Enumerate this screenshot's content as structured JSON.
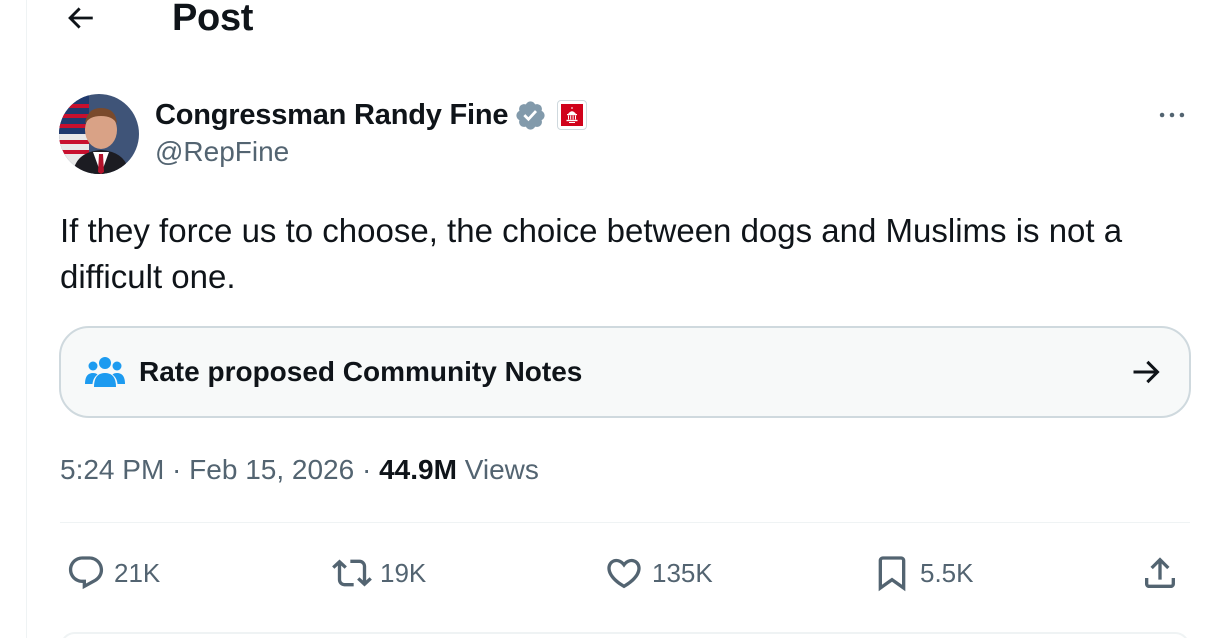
{
  "header": {
    "title": "Post"
  },
  "author": {
    "display_name": "Congressman Randy Fine",
    "handle": "@RepFine"
  },
  "post": {
    "text": "If they force us to choose, the choice between dogs and Muslims is not a difficult one."
  },
  "community_notes": {
    "label": "Rate proposed Community Notes"
  },
  "meta": {
    "time": "5:24 PM",
    "sep1": " · ",
    "date": "Feb 15, 2026",
    "sep2": " · ",
    "views_count": "44.9M",
    "views_label": " Views"
  },
  "actions": {
    "replies": "21K",
    "reposts": "19K",
    "likes": "135K",
    "bookmarks": "5.5K"
  },
  "colors": {
    "text_primary": "#0f1419",
    "text_secondary": "#536471",
    "verified_gray": "#829aab",
    "notes_blue": "#1d9bf0",
    "gov_red": "#d0021b",
    "border": "#cfd9de"
  },
  "icons": {
    "back": "arrow-left-icon",
    "verified": "verified-badge-icon",
    "gov": "government-badge-icon",
    "more": "more-icon",
    "notes": "community-notes-icon",
    "arrow": "arrow-right-icon",
    "reply": "reply-icon",
    "repost": "repost-icon",
    "like": "heart-icon",
    "bookmark": "bookmark-icon",
    "share": "share-icon"
  }
}
